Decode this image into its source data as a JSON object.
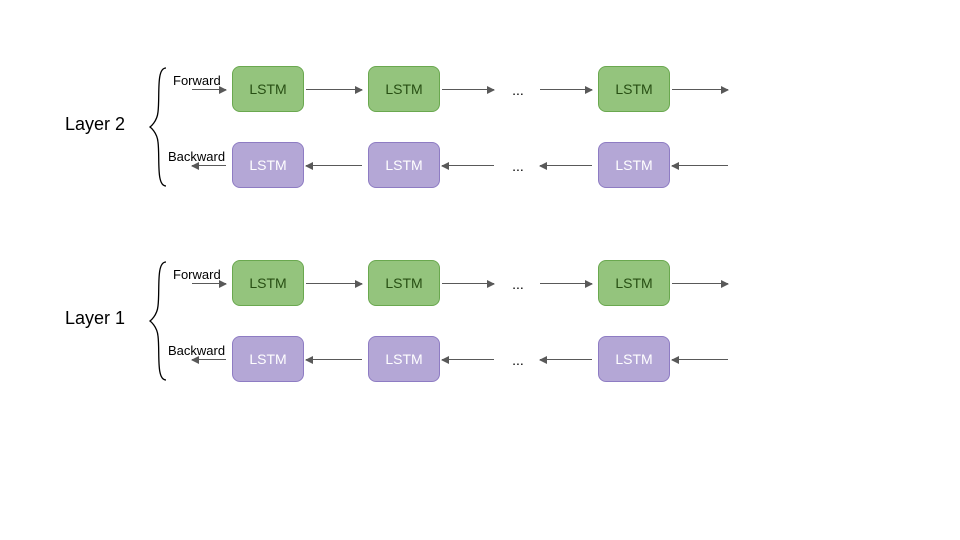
{
  "diagram": {
    "type": "bidirectional-lstm-stack",
    "cell_label": "LSTM",
    "ellipsis": "...",
    "colors": {
      "forward_fill": "#94C47D",
      "forward_border": "#6AA84F",
      "forward_text": "#274E13",
      "backward_fill": "#B4A7D6",
      "backward_border": "#8E7CC3",
      "backward_text": "#FFFFFF",
      "arrow": "#595959"
    },
    "layers": [
      {
        "name": "Layer 2",
        "forward_label": "Forward",
        "backward_label": "Backward"
      },
      {
        "name": "Layer 1",
        "forward_label": "Forward",
        "backward_label": "Backward"
      }
    ],
    "cells_shown_per_row": 3,
    "ellipsis_between_index": 2
  }
}
